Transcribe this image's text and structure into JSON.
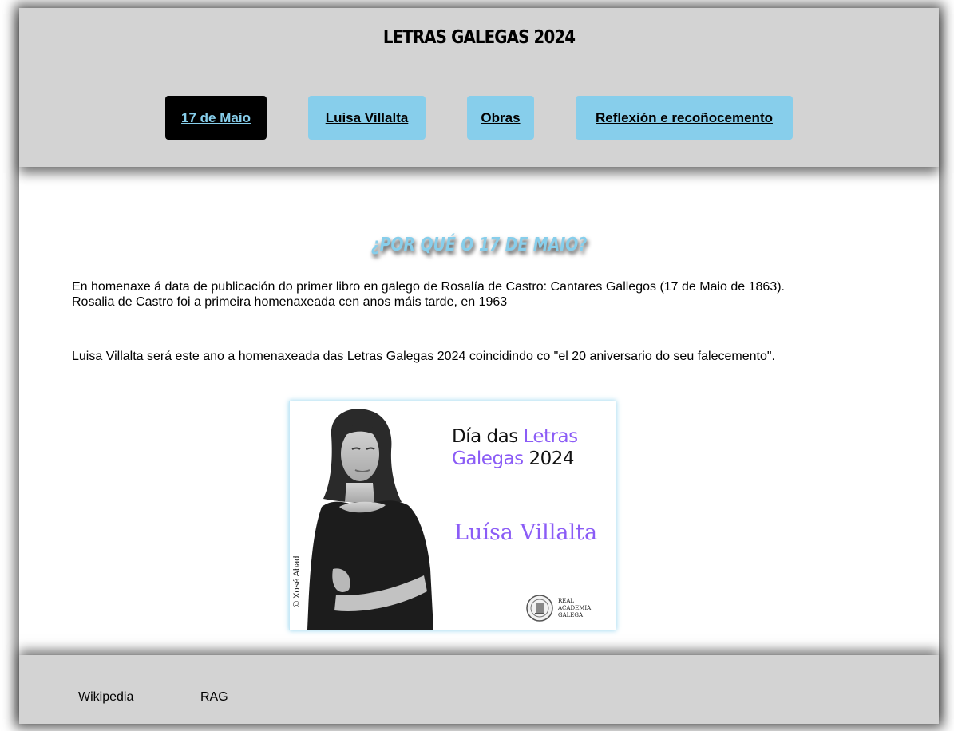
{
  "header": {
    "title": "LETRAS GALEGAS 2024",
    "nav": [
      {
        "label": "17 de Maio",
        "active": true
      },
      {
        "label": "Luisa Villalta",
        "active": false
      },
      {
        "label": "Obras",
        "active": false
      },
      {
        "label": "Reflexión e recoñocemento",
        "active": false
      }
    ]
  },
  "main": {
    "heading": "¿POR QUÉ O 17 DE MAIO?",
    "paragraph1_line1": "En homenaxe á data de publicación do primer libro en galego de Rosalía de Castro: Cantares Gallegos (17 de Maio de 1863).",
    "paragraph1_line2": "Rosalia de Castro foi a primeira homenaxeada cen anos máis tarde, en 1963",
    "paragraph2": "Luisa Villalta será este ano a homenaxeada das Letras Galegas 2024 coincidindo co \"el 20 aniversario do seu falecemento\".",
    "poster": {
      "title_part1": "Día das ",
      "title_part2": "Letras",
      "title_part3": "Galegas",
      "title_part4": " 2024",
      "name": "Luísa Villalta",
      "credit": "© Xosé Abad",
      "institution_line1": "REAL",
      "institution_line2": "ACADEMIA",
      "institution_line3": "GALEGA"
    }
  },
  "footer": {
    "links": [
      "Wikipedia",
      "RAG"
    ]
  },
  "colors": {
    "accent": "#87ceeb",
    "bar": "#d3d3d3",
    "active_tab_bg": "#000000",
    "poster_violet": "#8b5cf6"
  }
}
